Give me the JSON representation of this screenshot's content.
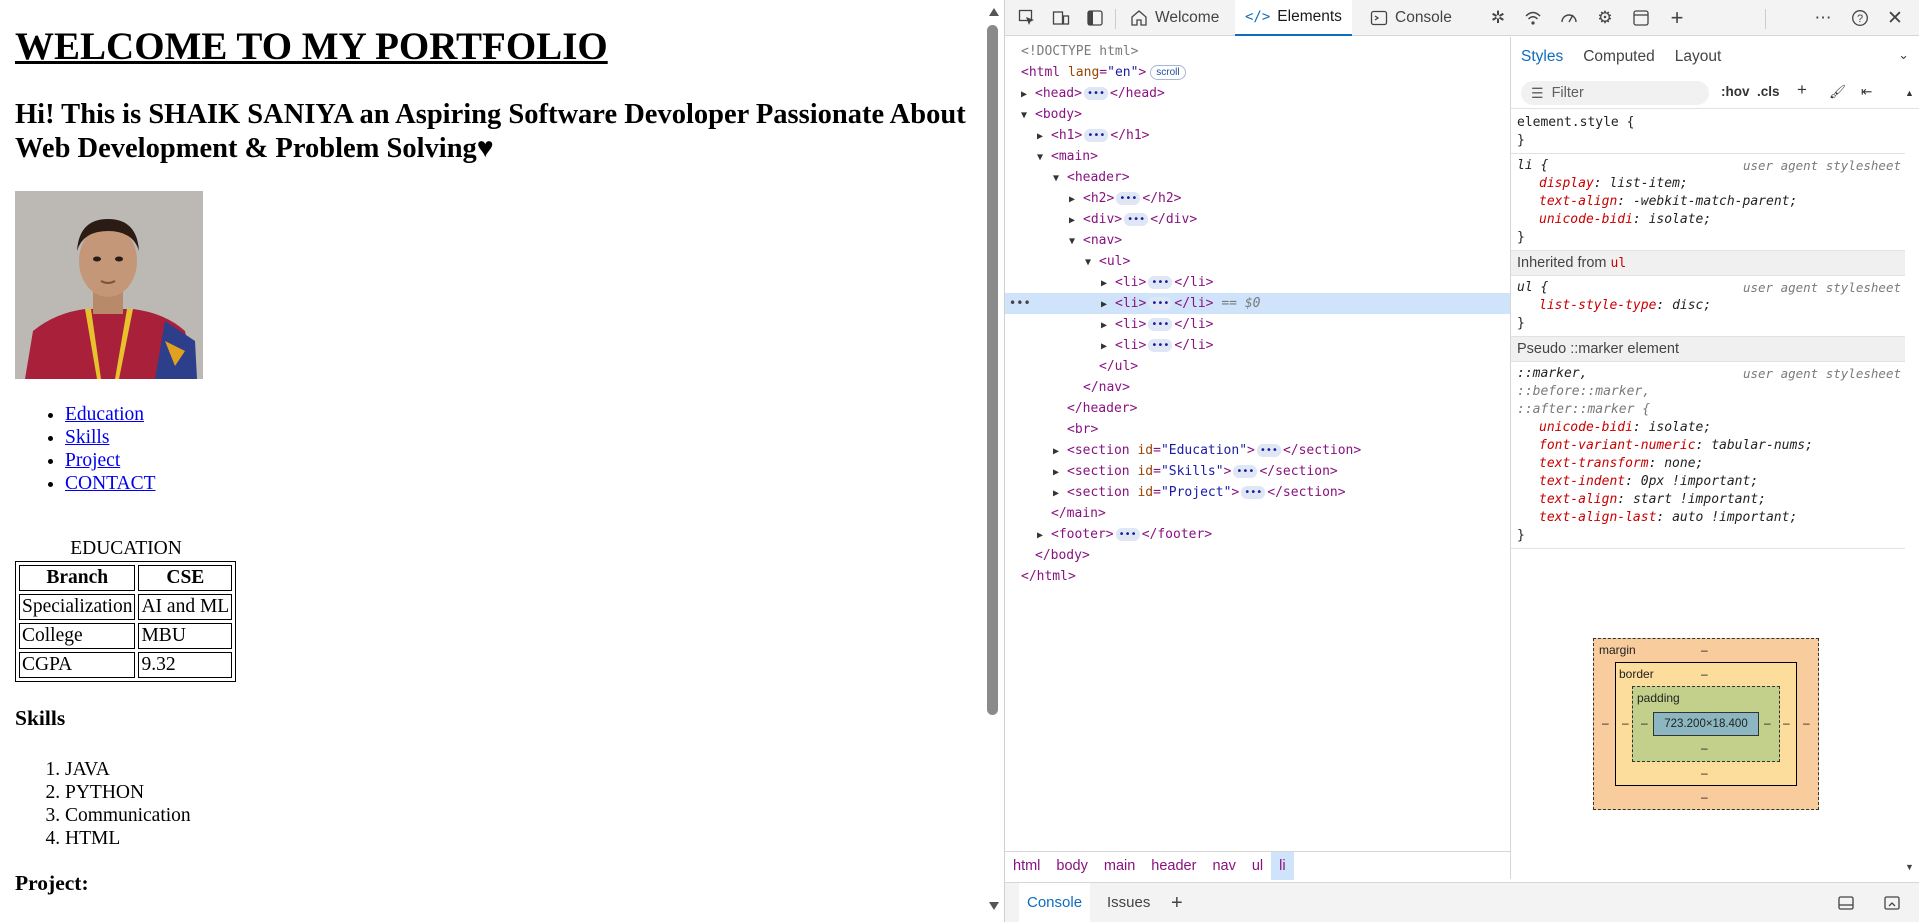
{
  "page": {
    "h1": "WELCOME TO MY PORTFOLIO",
    "h2": "Hi! This is SHAIK SANIYA an Aspiring Software Devoloper Passionate About Web Development & Problem Solving♥",
    "nav": [
      "Education",
      "Skills",
      "Project",
      "CONTACT"
    ],
    "education": {
      "caption": "EDUCATION",
      "headers": [
        "Branch",
        "CSE"
      ],
      "rows": [
        [
          "Specialization",
          "AI and ML"
        ],
        [
          "College",
          "MBU"
        ],
        [
          "CGPA",
          "9.32"
        ]
      ]
    },
    "skills": {
      "heading": "Skills",
      "items": [
        "JAVA",
        "PYTHON",
        "Communication",
        "HTML"
      ]
    },
    "project": {
      "heading": "Project:"
    }
  },
  "devtools": {
    "tabs": {
      "welcome": "Welcome",
      "elements": "Elements",
      "console": "Console"
    },
    "dom": {
      "doctype": "<!DOCTYPE html>",
      "scroll_badge": "scroll",
      "selected_marker": "== $0",
      "attrs": {
        "lang": "en",
        "sec1": "Education",
        "sec2": "Skills",
        "sec3": "Project"
      }
    },
    "breadcrumbs": [
      "html",
      "body",
      "main",
      "header",
      "nav",
      "ul",
      "li"
    ],
    "styles": {
      "tabs": [
        "Styles",
        "Computed",
        "Layout"
      ],
      "filter_placeholder": "Filter",
      "hov": ":hov",
      "cls": ".cls",
      "element_style": "element.style {",
      "ua": "user agent stylesheet",
      "li_rule": {
        "selector": "li {",
        "decls": [
          [
            "display",
            "list-item;"
          ],
          [
            "text-align",
            "-webkit-match-parent;"
          ],
          [
            "unicode-bidi",
            "isolate;"
          ]
        ]
      },
      "inherited_label": "Inherited from",
      "inherited_tag": "ul",
      "ul_rule": {
        "selector": "ul {",
        "decls": [
          [
            "list-style-type",
            "disc;"
          ]
        ]
      },
      "pseudo_label": "Pseudo ::marker element",
      "marker_selectors": [
        "::marker,",
        "::before::marker,",
        "::after::marker {"
      ],
      "marker_decls": [
        [
          "unicode-bidi",
          "isolate;"
        ],
        [
          "font-variant-numeric",
          "tabular-nums;"
        ],
        [
          "text-transform",
          "none;"
        ],
        [
          "text-indent",
          "0px !important;"
        ],
        [
          "text-align",
          "start !important;"
        ],
        [
          "text-align-last",
          "auto !important;"
        ]
      ],
      "close_brace": "}"
    },
    "box_model": {
      "margin": "margin",
      "border": "border",
      "padding": "padding",
      "content": "723.200×18.400",
      "dash": "–"
    },
    "bottom_tabs": [
      "Console",
      "Issues"
    ]
  }
}
